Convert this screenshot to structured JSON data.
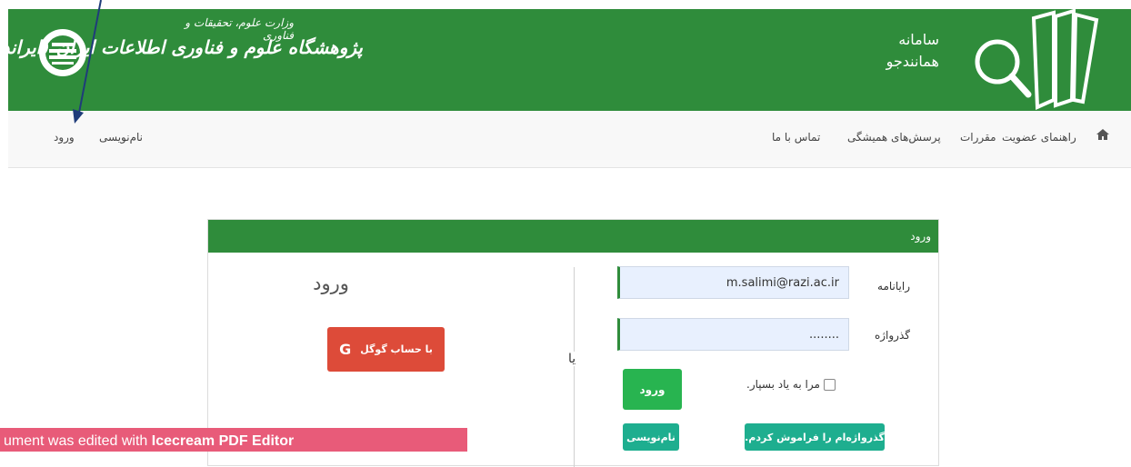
{
  "header": {
    "institute_subtitle": "وزارت علوم، تحقیقات و فناوری",
    "institute_title": "پژوهشگاه علوم و فناوری اطلاعات ایران (ایرانداک)",
    "brand_line1": "سامانه",
    "brand_line2": "همانندجو"
  },
  "navbar": {
    "right_items": [
      "راهنمای عضویت",
      "مقررات",
      "پرسش‌های همیشگی",
      "تماس با ما"
    ],
    "left_items": [
      "نام‌نویسی",
      "ورود"
    ],
    "home_icon": "home-icon"
  },
  "panel": {
    "heading": "ورود",
    "login_title": "ورود",
    "google_label": "با حساب گوگل",
    "google_icon_letter": "G",
    "or_text": "یا",
    "email_label": "رایانامه",
    "email_value": "m.salimi@razi.ac.ir",
    "password_label": "گذرواژه",
    "password_value": "........",
    "remember_label": "مرا به یاد بسپار.",
    "submit_label": "ورود",
    "forgot_label": "گذرواژه‌ام را فراموش کردم.",
    "register_label": "نام‌نویسی"
  },
  "watermark": {
    "prefix": "ument was edited with ",
    "brand": "Icecream PDF Editor"
  },
  "colors": {
    "header_green": "#2f8c3b",
    "submit_green": "#28b450",
    "teal": "#1eae8f",
    "google_red": "#dd4b39",
    "watermark_pink": "#e85b79"
  }
}
